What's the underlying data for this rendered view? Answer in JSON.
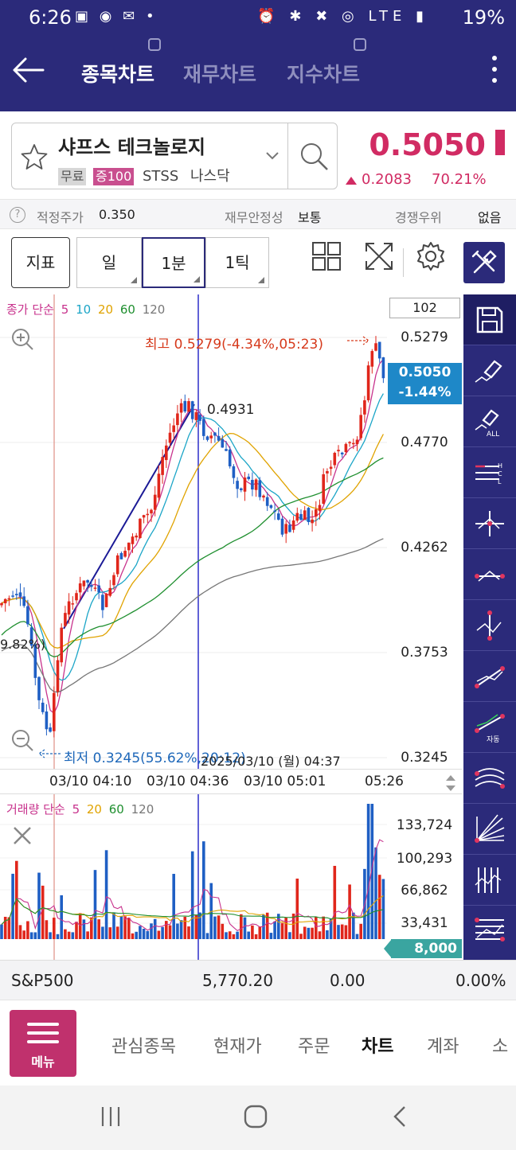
{
  "status_bar": {
    "time": "6:26",
    "icons_left": "▣ ◉ ✉ •",
    "icons_right": "⏰ ✱ ✖ ◎ LTE ▮",
    "battery": "19%"
  },
  "header": {
    "tabs": [
      {
        "label": "종목차트",
        "active": true
      },
      {
        "label": "재무차트",
        "active": false
      },
      {
        "label": "지수차트",
        "active": false
      }
    ]
  },
  "stock": {
    "name": "샤프스 테크놀로지",
    "tag_free": "무료",
    "tag_margin": "증100",
    "ticker": "STSS",
    "market": "나스닥",
    "price": "0.5050",
    "change": "0.2083",
    "change_pct": "70.21%"
  },
  "info_row": {
    "fair_price_label": "적정주가",
    "fair_price": "0.350",
    "stability_label": "재무안정성",
    "stability": "보통",
    "competition_label": "경쟁우위",
    "competition": "없음"
  },
  "toolbar": {
    "indicator": "지표",
    "day": "일",
    "minute": "1분",
    "tick": "1틱"
  },
  "chart": {
    "price_legend": {
      "prefix": "종가 단순",
      "ma": [
        "5",
        "10",
        "20",
        "60",
        "120"
      ]
    },
    "volume_legend": {
      "prefix": "거래량 단순",
      "ma": [
        "5",
        "20",
        "60",
        "120"
      ]
    },
    "count": "102",
    "y_labels": [
      "0.5279",
      "0.4770",
      "0.4262",
      "0.3753",
      "0.3245"
    ],
    "current_price": "0.5050",
    "current_pct": "-1.44%",
    "high_annotation": "최고 0.5279(-4.34%,05:23)",
    "low_annotation": "최저 0.3245(55.62%,20:12)",
    "peak_label": "0.4931",
    "left_pct": "9.82%)",
    "crosshair_date": "2025/03/10 (월) 04:37",
    "time_labels": [
      "03/10 04:10",
      "03/10 04:36",
      "03/10 05:01",
      "05:26"
    ],
    "vol_labels": [
      "133,724",
      "100,293",
      "66,862",
      "33,431"
    ],
    "vol_current": "8,000",
    "colors": {
      "up": "#e0261b",
      "down": "#1f5fc4",
      "ma5": "#c8338d",
      "ma10": "#1ba5c7",
      "ma20": "#e0a300",
      "ma60": "#1f8f2f",
      "ma120": "#777777"
    }
  },
  "index_row": {
    "name": "S&P500",
    "value": "5,770.20",
    "change": "0.00",
    "pct": "0.00%"
  },
  "bottom_nav": {
    "menu": "메뉴",
    "items": [
      {
        "label": "관심종목",
        "active": false
      },
      {
        "label": "현재가",
        "active": false
      },
      {
        "label": "주문",
        "active": false
      },
      {
        "label": "차트",
        "active": true
      },
      {
        "label": "계좌",
        "active": false
      },
      {
        "label": "소",
        "active": false
      }
    ]
  }
}
